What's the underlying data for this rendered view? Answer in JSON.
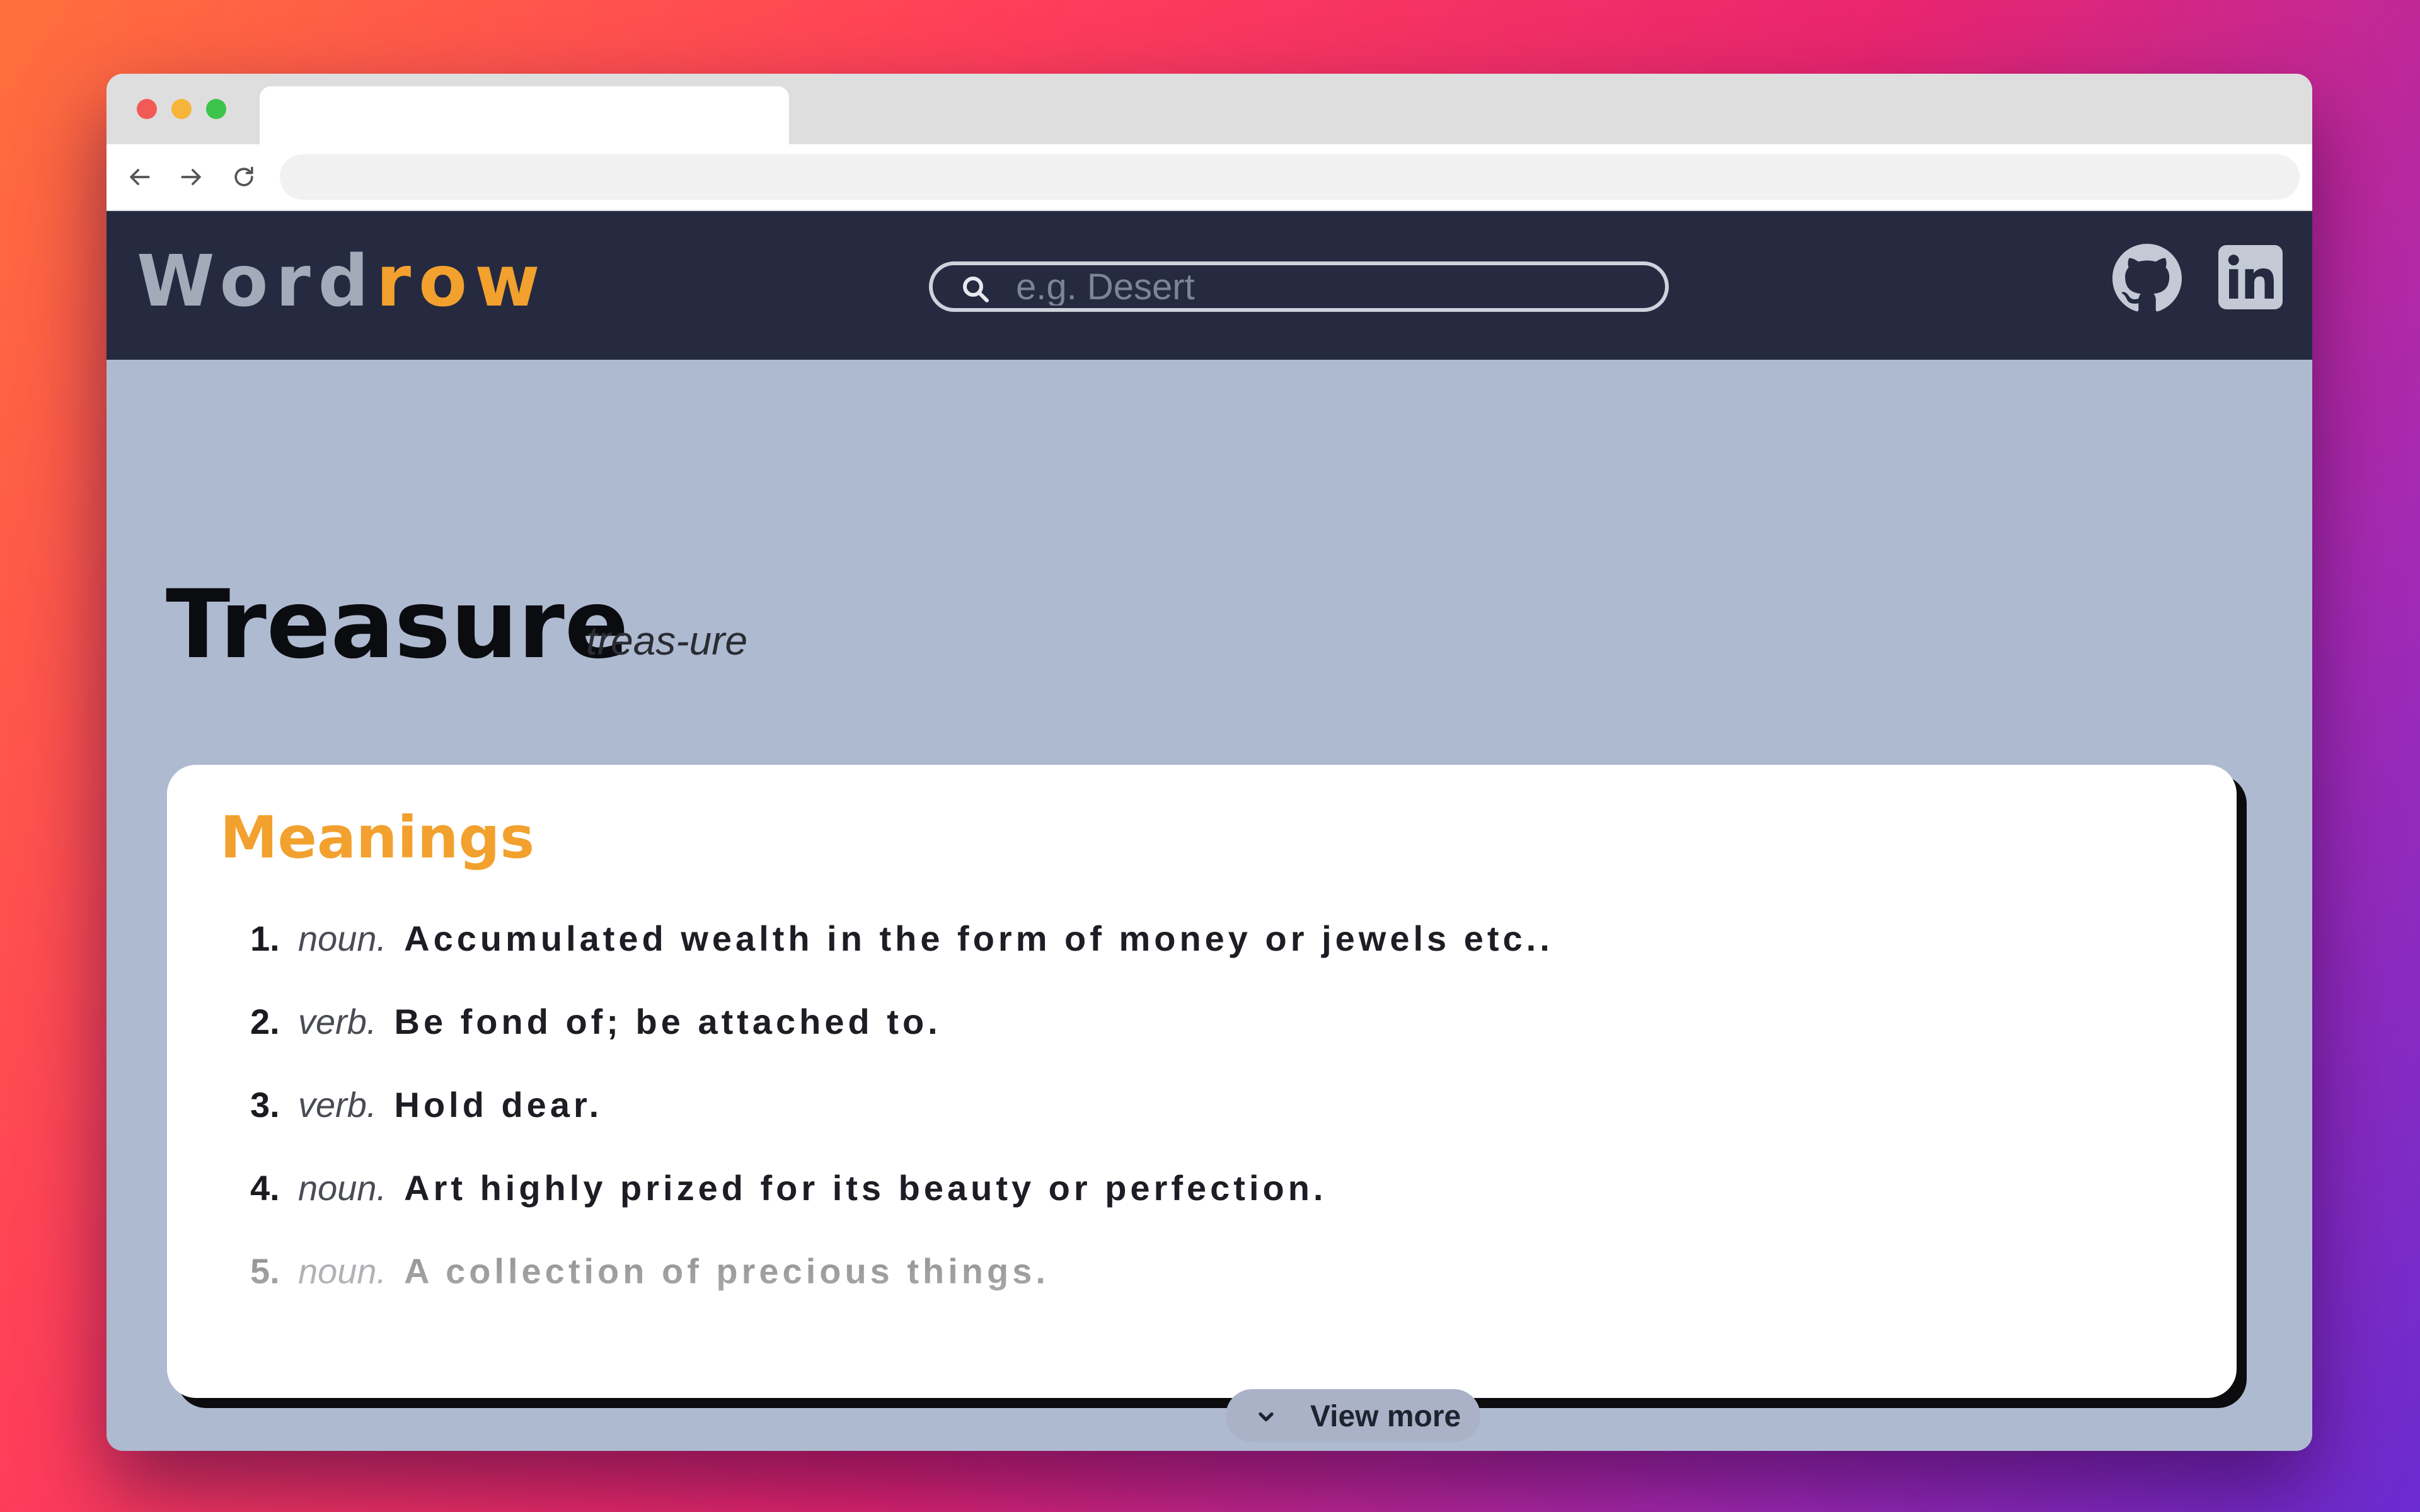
{
  "browser": {
    "tab_title": "",
    "url": ""
  },
  "header": {
    "logo_part1": "Word",
    "logo_part2": "row",
    "search_placeholder": "e.g. Desert",
    "search_value": "",
    "github_icon": "github-icon",
    "linkedin_icon": "linkedin-icon"
  },
  "word": {
    "title": "Treasure",
    "syllables": "treas-ure"
  },
  "meanings_card": {
    "heading": "Meanings",
    "items": [
      {
        "num": "1.",
        "pos": "noun.",
        "definition": "Accumulated wealth in the form of money or jewels etc.."
      },
      {
        "num": "2.",
        "pos": "verb.",
        "definition": "Be fond of; be attached to."
      },
      {
        "num": "3.",
        "pos": "verb.",
        "definition": "Hold dear."
      },
      {
        "num": "4.",
        "pos": "noun.",
        "definition": "Art highly prized for its beauty or perfection."
      },
      {
        "num": "5.",
        "pos": "noun.",
        "definition": "A collection of precious things."
      }
    ],
    "view_more_label": "View more"
  },
  "colors": {
    "header_bg": "#252a40",
    "page_bg": "#aebad0",
    "accent": "#f2a12e",
    "logo_muted": "#a3aab9"
  }
}
